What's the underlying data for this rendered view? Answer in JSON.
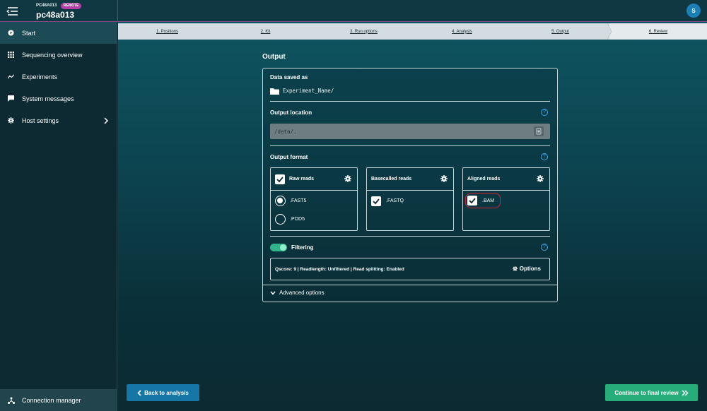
{
  "header": {
    "device_id": "PC48A013",
    "badge": "REMOTE",
    "device_name": "pc48a013",
    "user_initial": "S"
  },
  "sidebar": {
    "items": [
      {
        "label": "Start",
        "icon": "play-circle-icon",
        "active": true
      },
      {
        "label": "Sequencing overview",
        "icon": "grid-icon"
      },
      {
        "label": "Experiments",
        "icon": "trend-line-icon"
      },
      {
        "label": "System messages",
        "icon": "chat-icon"
      },
      {
        "label": "Host settings",
        "icon": "gear-icon"
      }
    ],
    "connection_manager": "Connection manager"
  },
  "stepper": {
    "steps": [
      "1. Positions",
      "2. Kit",
      "3. Run options",
      "4. Analysis",
      "5. Output",
      "6. Review"
    ],
    "current": "6. Review"
  },
  "page": {
    "title": "Output"
  },
  "output": {
    "data_saved_label": "Data saved as",
    "data_saved_path": "Experiment_Name/",
    "location_label": "Output location",
    "location_value": "/data/.",
    "format_label": "Output format",
    "raw_reads": {
      "title": "Raw reads",
      "checked": true,
      "options": [
        ".FAST5",
        ".POD5"
      ],
      "selected": ".FAST5"
    },
    "basecalled_reads": {
      "title": "Basecalled reads",
      "option": ".FASTQ",
      "checked": true
    },
    "aligned_reads": {
      "title": "Aligned reads",
      "option": ".BAM",
      "checked": true
    },
    "filtering_label": "Filtering",
    "filtering_on": true,
    "filter_summary": "Qscore: 9 | Readlength: Unfiltered | Read splitting: Enabled",
    "options_label": "Options",
    "advanced_label": "Advanced options"
  },
  "footer": {
    "back_label": "Back to analysis",
    "continue_label": "Continue to final review"
  },
  "colors": {
    "accent_blue": "#1677a6",
    "accent_green": "#27ad7a",
    "highlight_red": "#d9232e",
    "badge_purple": "#b23fa8"
  }
}
